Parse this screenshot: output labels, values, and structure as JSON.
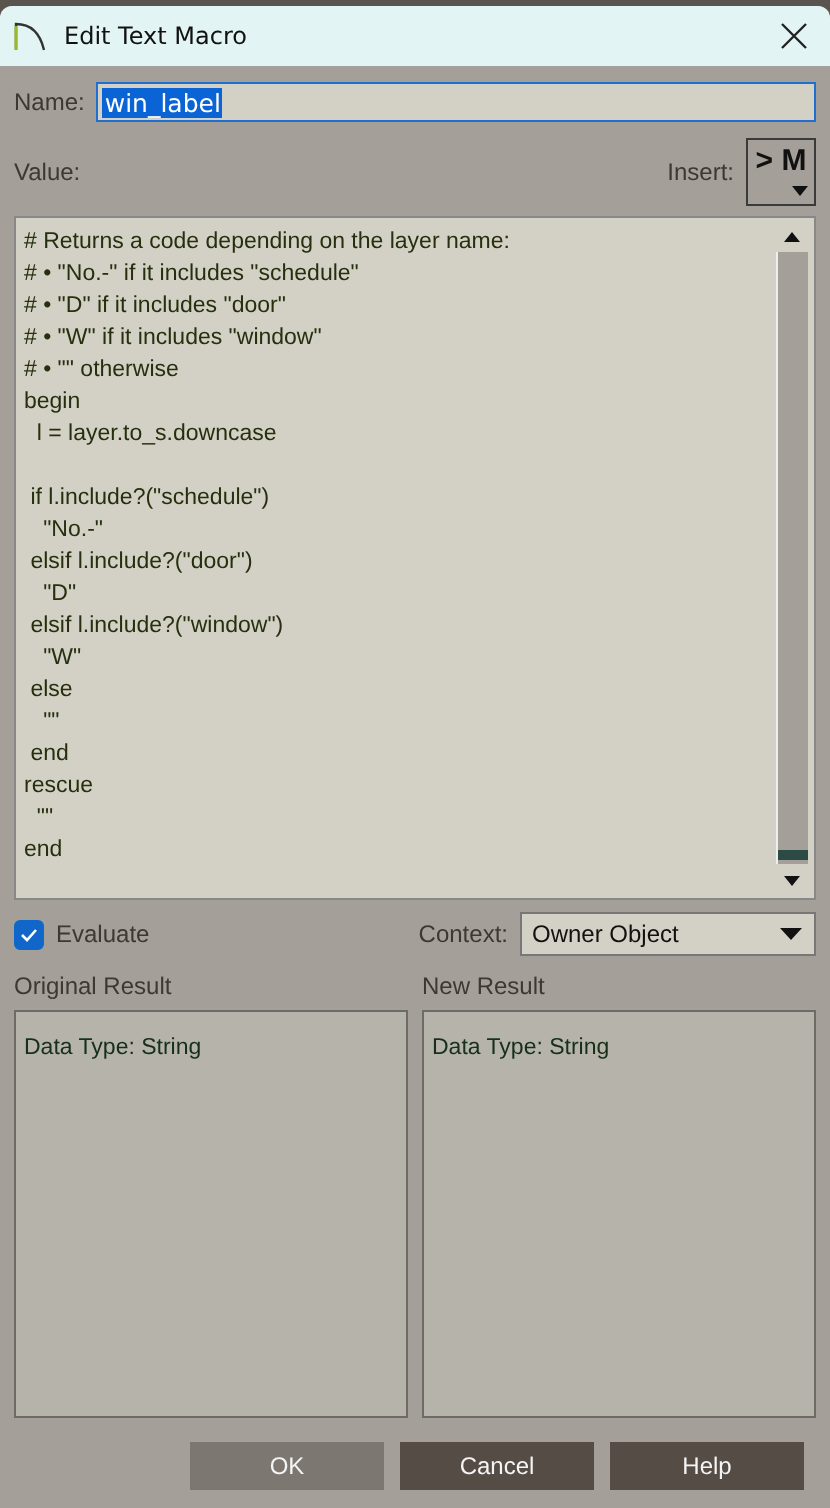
{
  "window": {
    "title": "Edit Text Macro"
  },
  "name": {
    "label": "Name:",
    "value": "win_label",
    "selected": true
  },
  "value_label": "Value:",
  "insert": {
    "label": "Insert:",
    "button": "> M"
  },
  "code_blocks": [
    [
      "# Returns a code depending on the layer name:",
      "# • \"No.-\" if it includes \"schedule\"",
      "# • \"D\" if it includes \"door\"",
      "# • \"W\" if it includes \"window\"",
      "# • \"\" otherwise",
      "begin",
      "  l = layer.to_s.downcase"
    ],
    [
      " if l.include?(\"schedule\")",
      "   \"No.-\"",
      " elsif l.include?(\"door\")",
      "   \"D\"",
      " elsif l.include?(\"window\")",
      "   \"W\"",
      " else",
      "   \"\"",
      " end",
      "rescue",
      "  \"\"",
      "end"
    ]
  ],
  "evaluate": {
    "label": "Evaluate",
    "checked": true
  },
  "context": {
    "label": "Context:",
    "value": "Owner Object"
  },
  "results": [
    {
      "title": "Original Result",
      "text": "Data Type: String"
    },
    {
      "title": "New Result",
      "text": "Data Type: String"
    }
  ],
  "buttons": [
    {
      "label": "OK",
      "default": true
    },
    {
      "label": "Cancel",
      "default": false
    },
    {
      "label": "Help",
      "default": false
    }
  ]
}
